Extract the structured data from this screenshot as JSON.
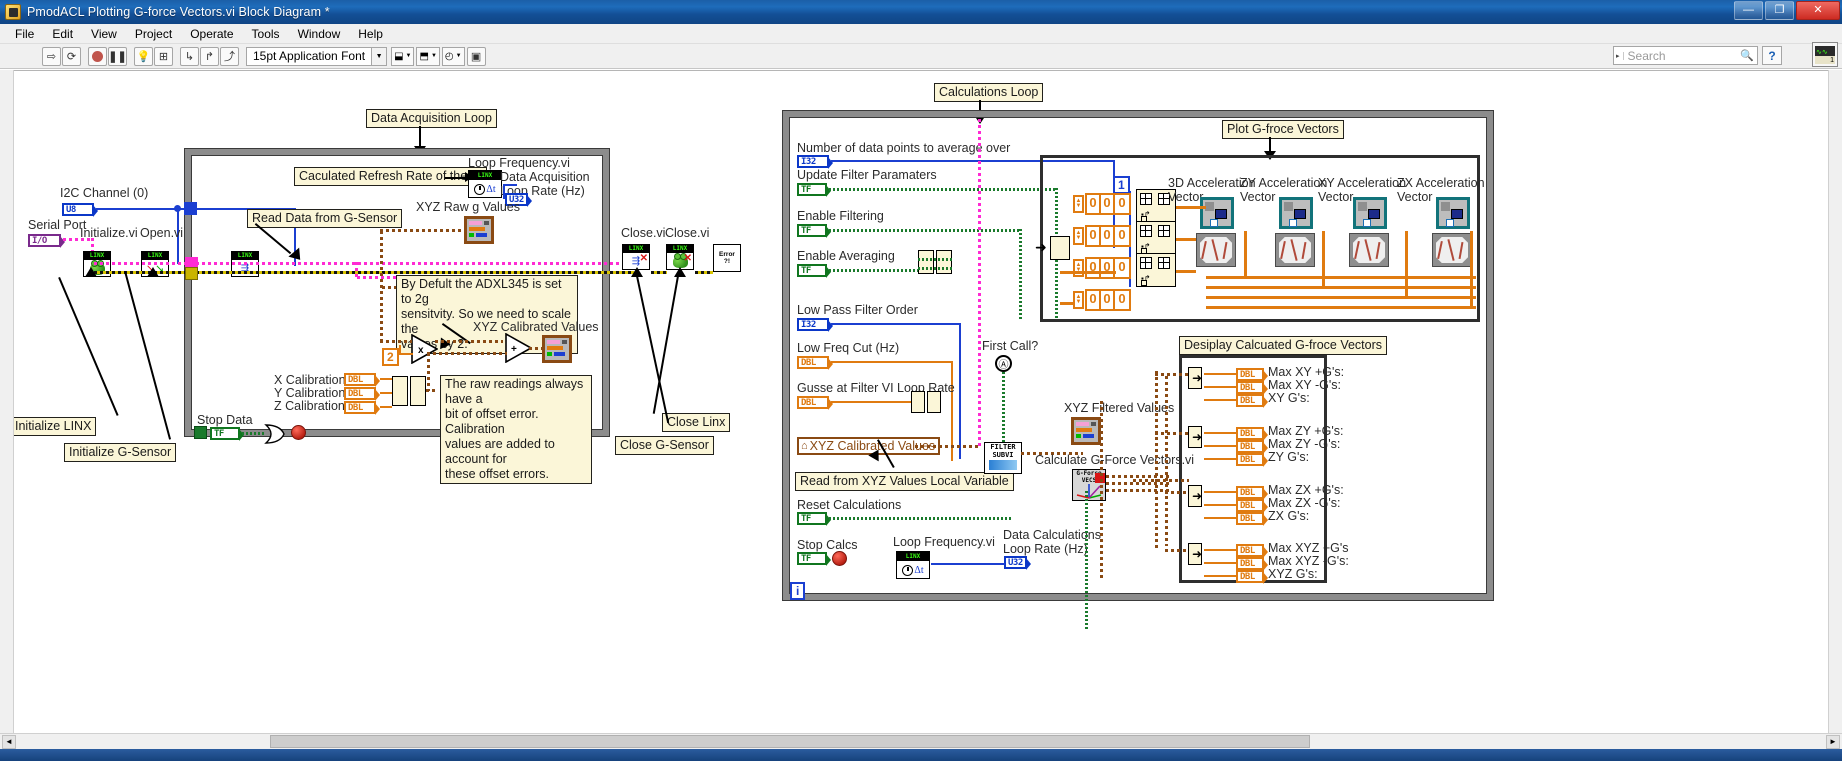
{
  "window": {
    "title": "PmodACL Plotting G-force Vectors.vi Block Diagram *",
    "icon": "labview-vi-icon",
    "buttons": {
      "minimize": "—",
      "maximize": "❐",
      "close": "✕"
    }
  },
  "menubar": {
    "items": [
      "File",
      "Edit",
      "View",
      "Project",
      "Operate",
      "Tools",
      "Window",
      "Help"
    ]
  },
  "toolbar": {
    "run_icon": "run-arrow-icon",
    "run_continuous_icon": "run-continuously-icon",
    "abort_icon": "abort-execution-icon",
    "pause_icon": "pause-icon",
    "highlight_icon": "highlight-execution-icon",
    "retain_icon": "retain-wire-values-icon",
    "stepinto_icon": "step-into-icon",
    "stepover_icon": "step-over-icon",
    "stepout_icon": "step-out-icon",
    "font_label": "15pt Application Font",
    "align_icon": "align-objects-icon",
    "distribute_icon": "distribute-objects-icon",
    "resize_icon": "resize-objects-icon",
    "reorder_icon": "reorder-icon",
    "help_icon": "context-help-icon"
  },
  "search": {
    "placeholder": "Search",
    "icon": "magnifier-icon",
    "caret": "▸"
  },
  "diagram": {
    "left_panel": {
      "annotations": {
        "data_acquisition_loop": "Data Acquisition Loop",
        "calculated_refresh": "Caculated Refresh Rate of the VI",
        "read_data": "Read Data from G-Sensor",
        "adxl_note": "By Defult the ADXL345 is set to 2g\nsensitvity. So we need to scale the\nvalues by 2.",
        "offset_note": "The raw readings always have a\nbit of offset error. Calibration\nvalues are added to account for\nthese offset errors.",
        "initialize_linx": "Initialize LINX",
        "initialize_gsensor": "Initialize G-Sensor",
        "close_gsensor": "Close G-Sensor",
        "close_linx": "Close Linx"
      },
      "labels": {
        "i2c_channel": "I2C Channel (0)",
        "serial_port": "Serial Port",
        "initialize_vi": "Initialize.vi",
        "open_vi": "Open.vi",
        "loop_frequency_vi": "Loop Frequency.vi",
        "daq_loop_rate": "Data Acquisition\nLoop Rate (Hz)",
        "xyz_raw": "XYZ Raw g Values",
        "xyz_calibrated": "XYZ Calibrated Values",
        "x_calibration": "X Calibration",
        "y_calibration": "Y Calibration",
        "z_calibration": "Z Calibration",
        "stop_data": "Stop Data",
        "close_vi_1": "Close.vi",
        "close_vi_2": "Close.vi"
      },
      "terminals": {
        "i2c_channel_type": "U8",
        "serial_port_type": "I/O",
        "loop_rate_type": "U32",
        "stop_data_type": "TF",
        "x_cal_type": "DBL",
        "y_cal_type": "DBL",
        "z_cal_type": "DBL",
        "scale_constant": "2"
      }
    },
    "right_panel": {
      "annotations": {
        "calculations_loop": "Calculations Loop",
        "plot_vectors": "Plot G-froce Vectors",
        "display_calc": "Desiplay Calcuated G-froce Vectors",
        "read_from_xyz": "Read from XYZ Values  Local Variable"
      },
      "controls": [
        {
          "label": "Number of data points to average over",
          "type": "I32"
        },
        {
          "label": "Update Filter Paramaters",
          "type": "TF"
        },
        {
          "label": "Enable Filtering",
          "type": "TF"
        },
        {
          "label": "Enable Averaging",
          "type": "TF"
        },
        {
          "label": "Low Pass Filter Order",
          "type": "I32"
        },
        {
          "label": "Low Freq Cut (Hz)",
          "type": "DBL"
        },
        {
          "label": "Gusse at Filter VI Loop Rate",
          "type": "DBL"
        },
        {
          "label": "Reset Calculations",
          "type": "TF"
        },
        {
          "label": "Stop Calcs",
          "type": "TF"
        }
      ],
      "local_variable": "XYZ Calibrated Values",
      "labels": {
        "first_call": "First Call?",
        "xyz_filtered": "XYZ Filtered Values",
        "calculate_gforce": "Calculate G-Force Vectors.vi",
        "loop_frequency_vi": "Loop Frequency.vi",
        "calc_loop_rate": "Data Calculations\nLoop Rate (Hz)",
        "calc_loop_rate_type": "U32",
        "filter_subvi": "FILTER\nSUBVI"
      },
      "plots": [
        {
          "label": "3D Acceleration\nVector"
        },
        {
          "label": "ZY Acceleration\nVector"
        },
        {
          "label": "XY Acceleration\nVector"
        },
        {
          "label": "ZX Acceleration\nVector"
        }
      ],
      "plot_index_constant": "1",
      "digit_groups": [
        "0 0 0",
        "0 0 0",
        "0 0 0",
        "0 0 0"
      ],
      "outputs": [
        [
          "Max XY +G's:",
          "Max XY -G's:",
          "XY G's:"
        ],
        [
          "Max ZY +G's:",
          "Max ZY -G's:",
          "ZY G's:"
        ],
        [
          "Max ZX +G's:",
          "Max ZX -G's:",
          "ZX G's:"
        ],
        [
          "Max XYZ +G's",
          "Max XYZ -G's:",
          "XYZ G's:"
        ]
      ],
      "output_terminal_type": "DBL"
    }
  },
  "scrollbar": {
    "left_arrow": "◄",
    "right_arrow": "►",
    "grip": "⋯"
  },
  "colors": {
    "titlebar": "#1e6cbb",
    "loop_frame": "#8c8c8c",
    "wire_orange": "#e07b10",
    "wire_blue": "#1b3fd1",
    "wire_green": "#1a7a2c",
    "wire_magenta": "#ff2ad4",
    "note_bg": "#fbf6d8"
  }
}
